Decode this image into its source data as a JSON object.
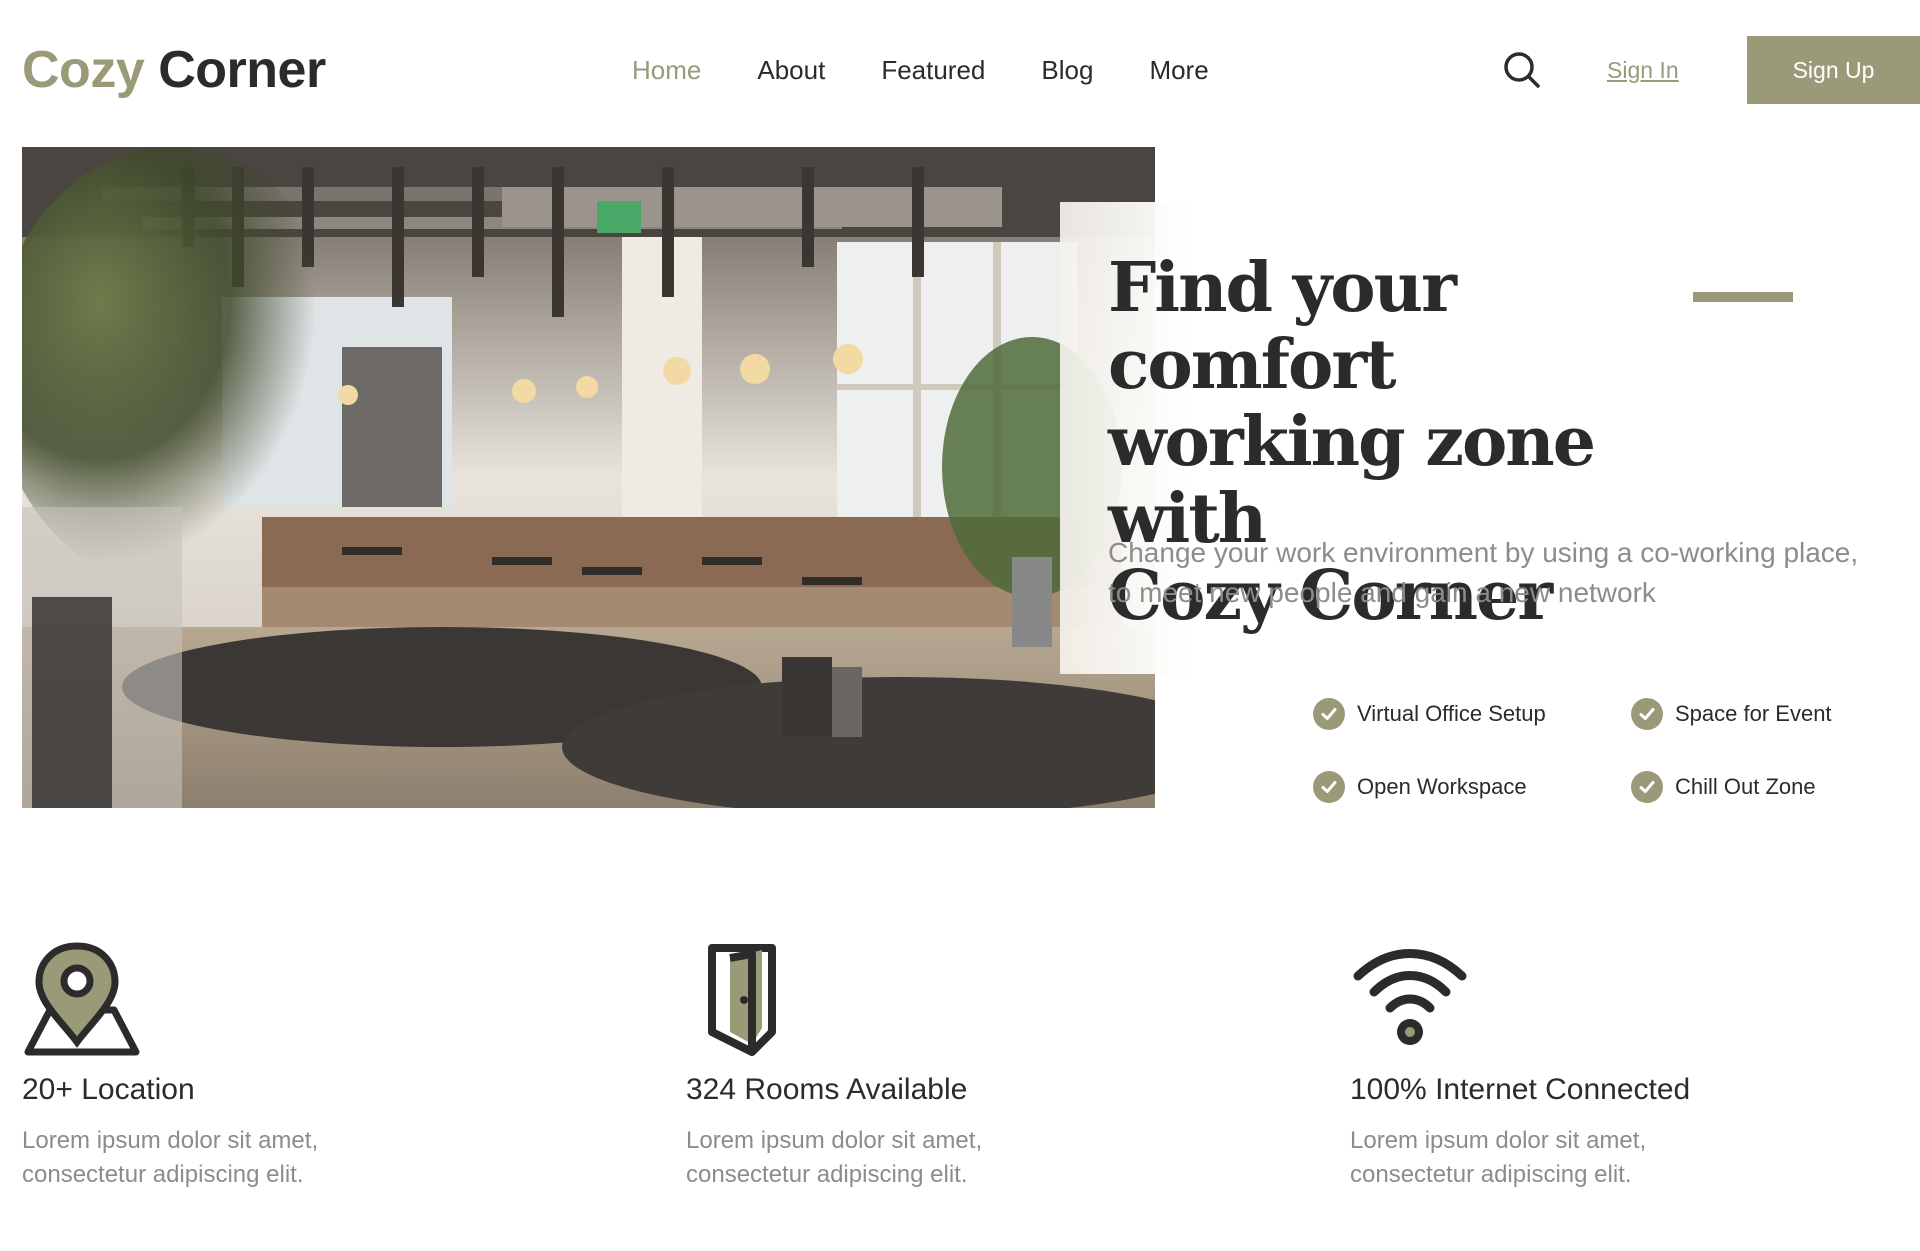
{
  "brand": {
    "name_part1": "Cozy",
    "name_part2": "Corner"
  },
  "nav": {
    "items": [
      {
        "label": "Home"
      },
      {
        "label": "About"
      },
      {
        "label": "Featured"
      },
      {
        "label": "Blog"
      },
      {
        "label": "More"
      }
    ]
  },
  "header": {
    "search_icon": "search-icon",
    "signin_label": "Sign In",
    "signup_label": "Sign Up"
  },
  "hero": {
    "headline_line1": "Find your comfort",
    "headline_line2": "working zone with",
    "headline_line3": "Cozy Corner",
    "subtitle_line1": "Change your work environment by using a co-working place,",
    "subtitle_line2": "to meet new people and gain a new network",
    "features": [
      {
        "label": "Virtual Office Setup"
      },
      {
        "label": "Space for Event"
      },
      {
        "label": "Open Workspace"
      },
      {
        "label": "Chill Out Zone"
      }
    ]
  },
  "stats": [
    {
      "icon": "location-pin-icon",
      "title": "20+ Location",
      "desc_line1": "Lorem ipsum dolor sit amet,",
      "desc_line2": "consectetur adipiscing elit."
    },
    {
      "icon": "door-icon",
      "title": "324 Rooms Available",
      "desc_line1": "Lorem ipsum dolor sit amet,",
      "desc_line2": "consectetur adipiscing elit."
    },
    {
      "icon": "wifi-icon",
      "title": "100% Internet Connected",
      "desc_line1": "Lorem ipsum dolor sit amet,",
      "desc_line2": "consectetur adipiscing elit."
    }
  ],
  "colors": {
    "accent": "#9a9a78",
    "text": "#2b2b2b",
    "muted": "#8c8c8c"
  }
}
